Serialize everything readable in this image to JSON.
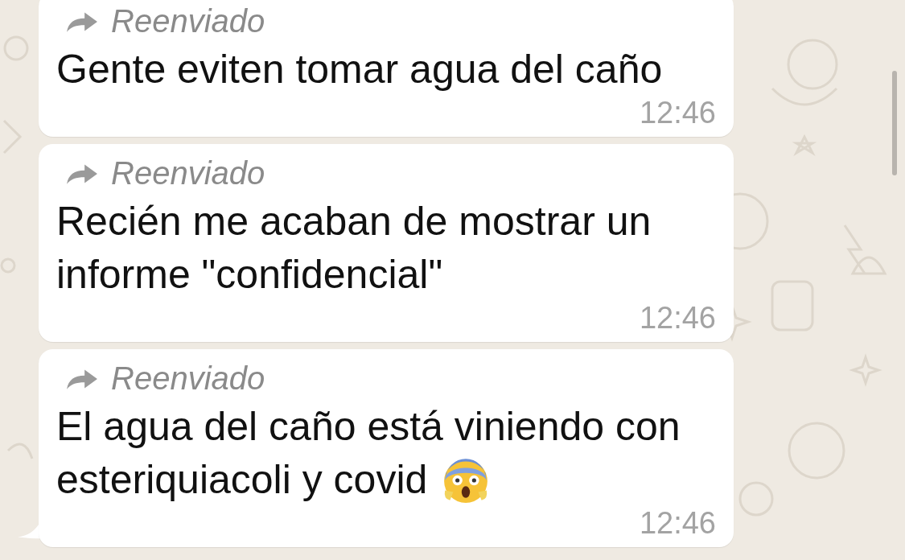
{
  "messages": [
    {
      "forwarded_label": "Reenviado",
      "lines": [
        "Gente eviten tomar agua del caño"
      ],
      "time": "12:46",
      "tail": false
    },
    {
      "forwarded_label": "Reenviado",
      "lines": [
        "Recién me acaban de mostrar un",
        "informe \"confidencial\""
      ],
      "time": "12:46",
      "tail": false
    },
    {
      "forwarded_label": "Reenviado",
      "lines": [
        "El agua del caño está viniendo con",
        "esteriquiacoli y covid"
      ],
      "time": "12:46",
      "tail": true,
      "emoji": true
    }
  ]
}
